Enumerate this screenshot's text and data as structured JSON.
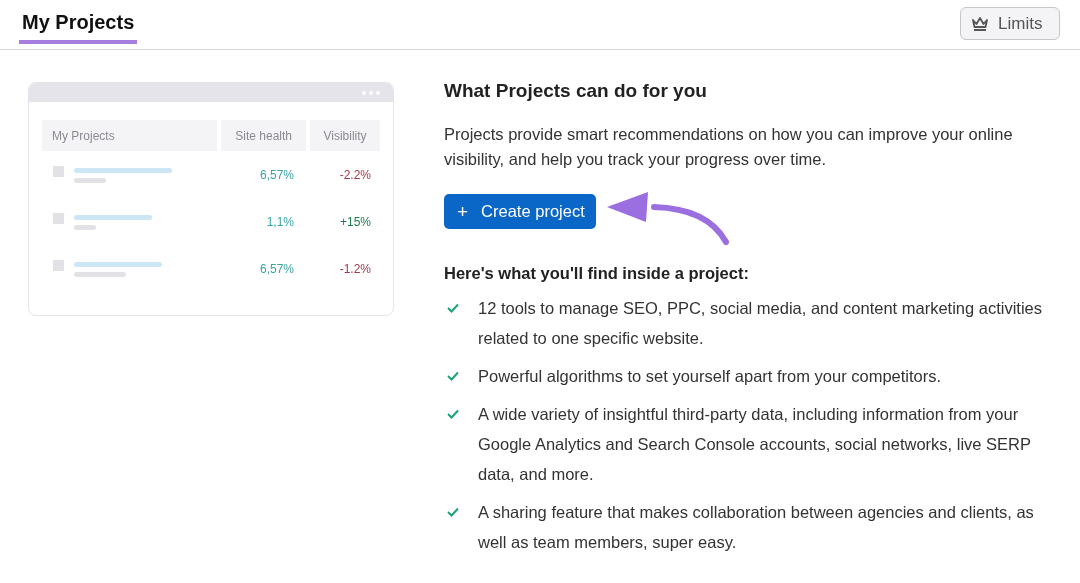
{
  "header": {
    "tabs": [
      {
        "label": "My Projects",
        "selected": true
      }
    ],
    "limits_button": {
      "label": "Limits"
    }
  },
  "preview": {
    "columns": [
      "My Projects",
      "Site health",
      "Visibility"
    ],
    "rows": [
      {
        "site_health": "6,57%",
        "visibility": "-2.2%",
        "color": "#a33a4a"
      },
      {
        "site_health": "1,1%",
        "visibility": "+15%",
        "color": "#1f7a4a"
      },
      {
        "site_health": "6,57%",
        "visibility": "-1.2%",
        "color": "#a33a4a"
      }
    ]
  },
  "intro": {
    "title": "What Projects can do for you",
    "text": "Projects provide smart recommendations on how you can improve your online visibility, and help you track your progress over time.",
    "button": "Create project",
    "button_icon": "+"
  },
  "features": {
    "title": "Here's what you'll find inside a project:",
    "items": [
      "12 tools to manage SEO, PPC, social media, and content marketing activities related to one specific website.",
      "Powerful algorithms to set yourself apart from your competitors.",
      "A wide variety of insightful third-party data, including information from your Google Analytics and Search Console accounts, social networks, live SERP data, and more.",
      "A sharing feature that makes collaboration between agencies and clients, as well as team members, super easy."
    ]
  }
}
